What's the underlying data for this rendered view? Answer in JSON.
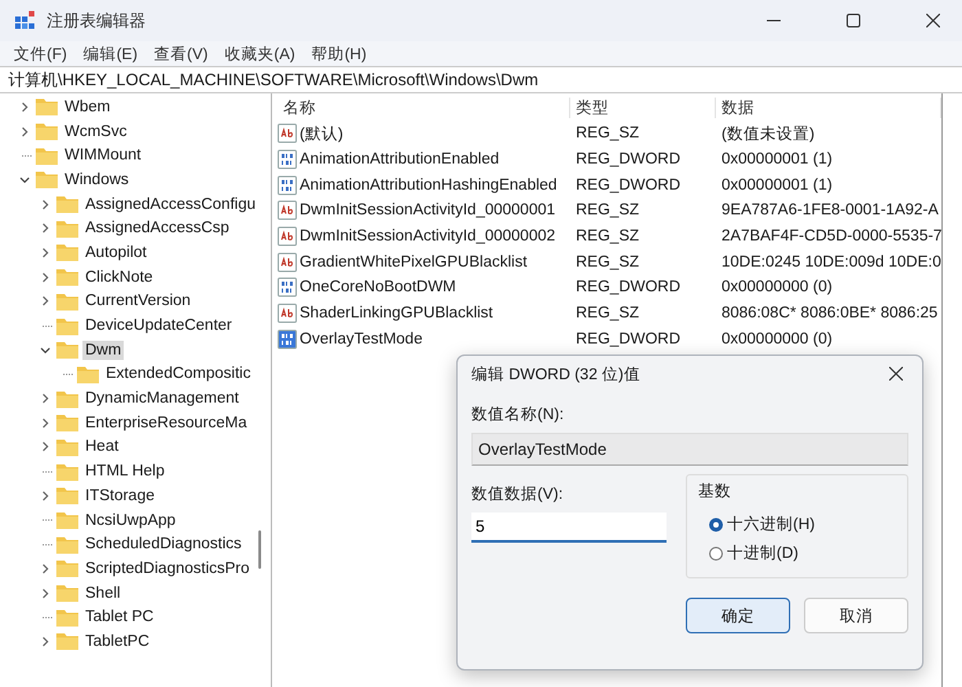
{
  "window": {
    "title": "注册表编辑器"
  },
  "menu": [
    "文件(F)",
    "编辑(E)",
    "查看(V)",
    "收藏夹(A)",
    "帮助(H)"
  ],
  "address": "计算机\\HKEY_LOCAL_MACHINE\\SOFTWARE\\Microsoft\\Windows\\Dwm",
  "tree": [
    {
      "label": "Wbem",
      "kind": "branch",
      "expanded": false,
      "selected": false
    },
    {
      "label": "WcmSvc",
      "kind": "branch",
      "expanded": false,
      "selected": false
    },
    {
      "label": "WIMMount",
      "kind": "leaf",
      "selected": false
    },
    {
      "label": "Windows",
      "kind": "branch",
      "expanded": true,
      "selected": false,
      "children": [
        {
          "label": "AssignedAccessConfigu",
          "kind": "branch",
          "expanded": false,
          "selected": false
        },
        {
          "label": "AssignedAccessCsp",
          "kind": "branch",
          "expanded": false,
          "selected": false
        },
        {
          "label": "Autopilot",
          "kind": "branch",
          "expanded": false,
          "selected": false
        },
        {
          "label": "ClickNote",
          "kind": "branch",
          "expanded": false,
          "selected": false
        },
        {
          "label": "CurrentVersion",
          "kind": "branch",
          "expanded": false,
          "selected": false
        },
        {
          "label": "DeviceUpdateCenter",
          "kind": "leaf",
          "selected": false
        },
        {
          "label": "Dwm",
          "kind": "branch",
          "expanded": true,
          "selected": true,
          "children": [
            {
              "label": "ExtendedCompositic",
              "kind": "leaf",
              "selected": false
            }
          ]
        },
        {
          "label": "DynamicManagement",
          "kind": "branch",
          "expanded": false,
          "selected": false
        },
        {
          "label": "EnterpriseResourceMa",
          "kind": "branch",
          "expanded": false,
          "selected": false
        },
        {
          "label": "Heat",
          "kind": "branch",
          "expanded": false,
          "selected": false
        },
        {
          "label": "HTML Help",
          "kind": "leaf",
          "selected": false
        },
        {
          "label": "ITStorage",
          "kind": "branch",
          "expanded": false,
          "selected": false
        },
        {
          "label": "NcsiUwpApp",
          "kind": "leaf",
          "selected": false
        },
        {
          "label": "ScheduledDiagnostics",
          "kind": "leaf",
          "selected": false
        },
        {
          "label": "ScriptedDiagnosticsPro",
          "kind": "branch",
          "expanded": false,
          "selected": false
        },
        {
          "label": "Shell",
          "kind": "branch",
          "expanded": false,
          "selected": false
        },
        {
          "label": "Tablet PC",
          "kind": "leaf",
          "selected": false
        },
        {
          "label": "TabletPC",
          "kind": "branch",
          "expanded": false,
          "selected": false
        }
      ]
    }
  ],
  "values": {
    "columns": [
      "名称",
      "类型",
      "数据"
    ],
    "rows": [
      {
        "kind": "sz",
        "name": "(默认)",
        "type": "REG_SZ",
        "data": "(数值未设置)",
        "selected": false
      },
      {
        "kind": "dword",
        "name": "AnimationAttributionEnabled",
        "type": "REG_DWORD",
        "data": "0x00000001 (1)",
        "selected": false
      },
      {
        "kind": "dword",
        "name": "AnimationAttributionHashingEnabled",
        "type": "REG_DWORD",
        "data": "0x00000001 (1)",
        "selected": false
      },
      {
        "kind": "sz",
        "name": "DwmInitSessionActivityId_00000001",
        "type": "REG_SZ",
        "data": "9EA787A6-1FE8-0001-1A92-A",
        "selected": false
      },
      {
        "kind": "sz",
        "name": "DwmInitSessionActivityId_00000002",
        "type": "REG_SZ",
        "data": "2A7BAF4F-CD5D-0000-5535-7",
        "selected": false
      },
      {
        "kind": "sz",
        "name": "GradientWhitePixelGPUBlacklist",
        "type": "REG_SZ",
        "data": "10DE:0245 10DE:009d 10DE:0",
        "selected": false
      },
      {
        "kind": "dword",
        "name": "OneCoreNoBootDWM",
        "type": "REG_DWORD",
        "data": "0x00000000 (0)",
        "selected": false
      },
      {
        "kind": "sz",
        "name": "ShaderLinkingGPUBlacklist",
        "type": "REG_SZ",
        "data": "8086:08C* 8086:0BE* 8086:25",
        "selected": false
      },
      {
        "kind": "dword",
        "name": "OverlayTestMode",
        "type": "REG_DWORD",
        "data": "0x00000000 (0)",
        "selected": true
      }
    ]
  },
  "dialog": {
    "title": "编辑 DWORD (32 位)值",
    "name_label": "数值名称(N):",
    "name_value": "OverlayTestMode",
    "data_label": "数值数据(V):",
    "data_value": "5",
    "base_label": "基数",
    "bases": [
      {
        "label": "十六进制(H)",
        "selected": true
      },
      {
        "label": "十进制(D)",
        "selected": false
      }
    ],
    "buttons": [
      {
        "label": "确定",
        "kind": "primary"
      },
      {
        "label": "取消",
        "kind": "secondary"
      }
    ]
  }
}
